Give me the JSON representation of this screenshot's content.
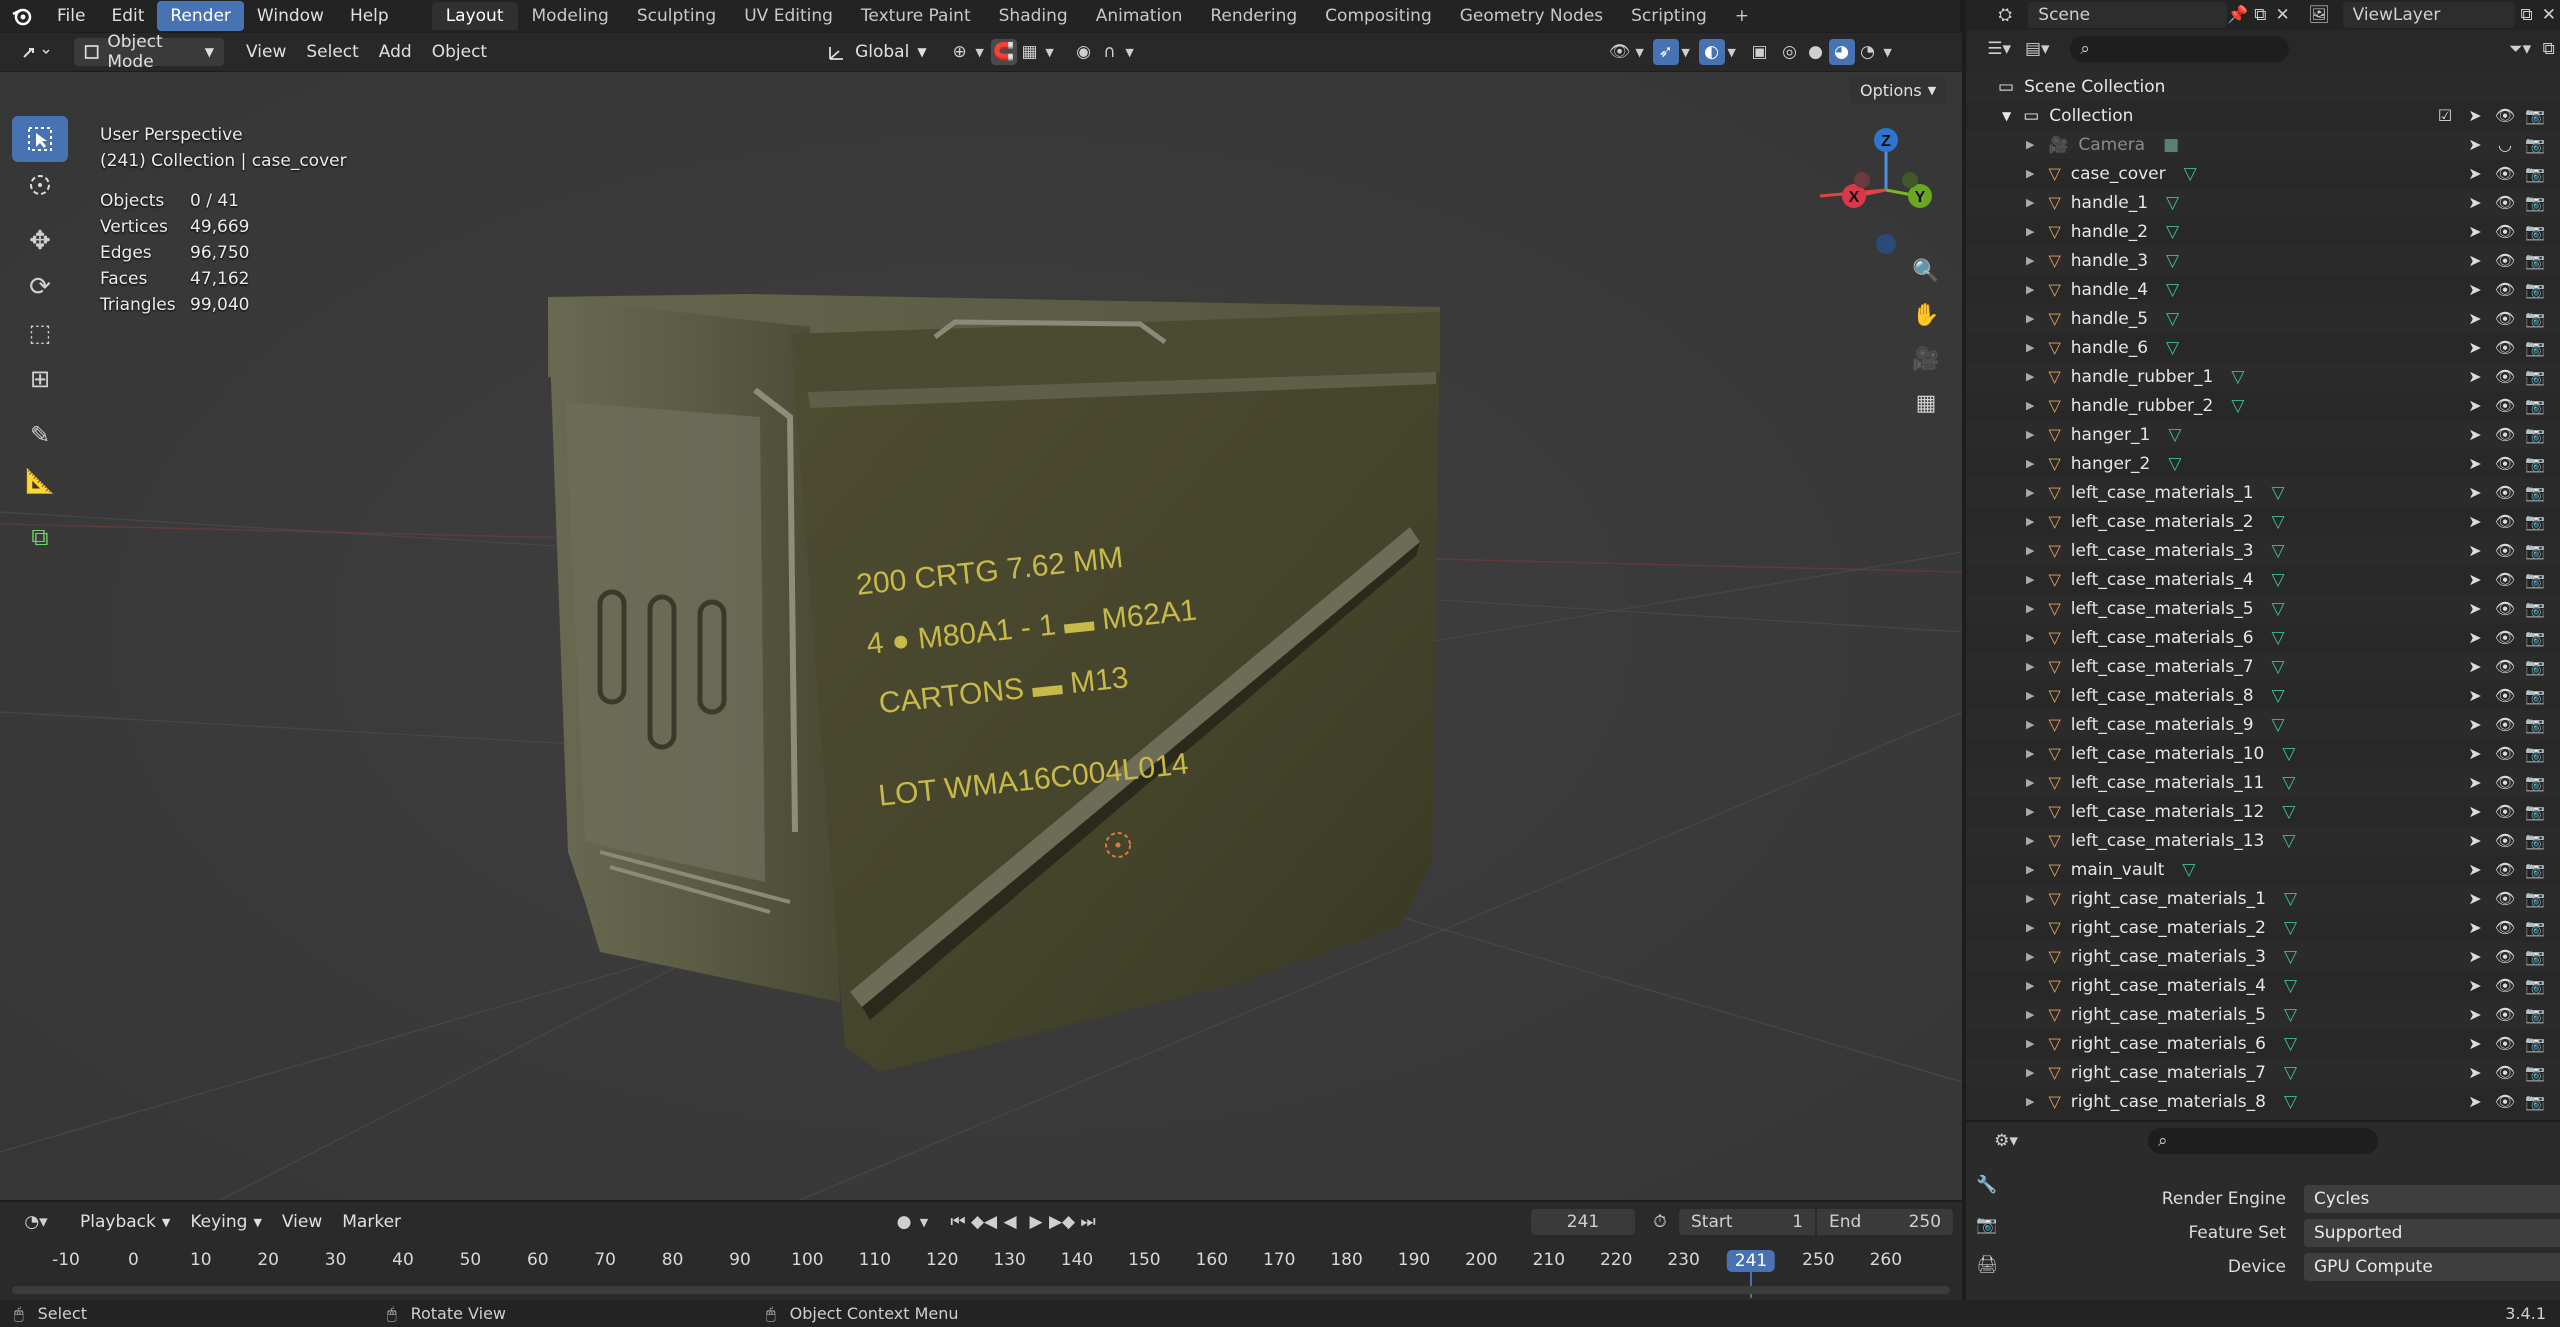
{
  "menubar": {
    "items": [
      "File",
      "Edit",
      "Render",
      "Window",
      "Help"
    ],
    "active": "Render",
    "workspaces": [
      "Layout",
      "Modeling",
      "Sculpting",
      "UV Editing",
      "Texture Paint",
      "Shading",
      "Animation",
      "Rendering",
      "Compositing",
      "Geometry Nodes",
      "Scripting"
    ],
    "active_workspace": "Layout",
    "add_tab": "+"
  },
  "scene": {
    "name": "Scene",
    "view_layer": "ViewLayer"
  },
  "viewport_header": {
    "mode": "Object Mode",
    "menus": [
      "View",
      "Select",
      "Add",
      "Object"
    ],
    "transform_orientation": "Global",
    "options": "Options"
  },
  "viewport": {
    "perspective": "User Perspective",
    "context": "(241) Collection | case_cover",
    "stats": [
      {
        "label": "Objects",
        "value": "0 / 41"
      },
      {
        "label": "Vertices",
        "value": "49,669"
      },
      {
        "label": "Edges",
        "value": "96,750"
      },
      {
        "label": "Faces",
        "value": "47,162"
      },
      {
        "label": "Triangles",
        "value": "99,040"
      }
    ],
    "gizmo": {
      "x": "X",
      "y": "Y",
      "z": "Z"
    },
    "box_text": {
      "line1": "200 CRTG 7.62 MM",
      "line2": "4 ● M80A1 - 1 ▬ M62A1",
      "line3": "CARTONS ▬ M13",
      "line4": "LOT WMA16C004L014"
    }
  },
  "outliner": {
    "search_placeholder": "",
    "scene_collection": "Scene Collection",
    "collection": "Collection",
    "objects": [
      "Camera",
      "case_cover",
      "handle_1",
      "handle_2",
      "handle_3",
      "handle_4",
      "handle_5",
      "handle_6",
      "handle_rubber_1",
      "handle_rubber_2",
      "hanger_1",
      "hanger_2",
      "left_case_materials_1",
      "left_case_materials_2",
      "left_case_materials_3",
      "left_case_materials_4",
      "left_case_materials_5",
      "left_case_materials_6",
      "left_case_materials_7",
      "left_case_materials_8",
      "left_case_materials_9",
      "left_case_materials_10",
      "left_case_materials_11",
      "left_case_materials_12",
      "left_case_materials_13",
      "main_vault",
      "right_case_materials_1",
      "right_case_materials_2",
      "right_case_materials_3",
      "right_case_materials_4",
      "right_case_materials_5",
      "right_case_materials_6",
      "right_case_materials_7",
      "right_case_materials_8"
    ]
  },
  "properties": {
    "rows": [
      {
        "label": "Render Engine",
        "value": "Cycles"
      },
      {
        "label": "Feature Set",
        "value": "Supported"
      },
      {
        "label": "Device",
        "value": "GPU Compute"
      }
    ]
  },
  "timeline": {
    "menus": [
      "Playback",
      "Keying",
      "View",
      "Marker"
    ],
    "current_frame": "241",
    "start_label": "Start",
    "start": "1",
    "end_label": "End",
    "end": "250",
    "ticks": [
      "-10",
      "0",
      "10",
      "20",
      "30",
      "40",
      "50",
      "60",
      "70",
      "80",
      "90",
      "100",
      "110",
      "120",
      "130",
      "140",
      "150",
      "160",
      "170",
      "180",
      "190",
      "200",
      "210",
      "220",
      "230",
      "241",
      "250",
      "260"
    ]
  },
  "statusbar": {
    "select": "Select",
    "rotate": "Rotate View",
    "context_menu": "Object Context Menu",
    "version": "3.4.1"
  },
  "colors": {
    "accent": "#4772b3",
    "object_icon": "#e8a25a",
    "mesh_icon": "#3fc28b",
    "box_green": "#4a4a2e",
    "stencil_yellow": "#c9b84a"
  }
}
